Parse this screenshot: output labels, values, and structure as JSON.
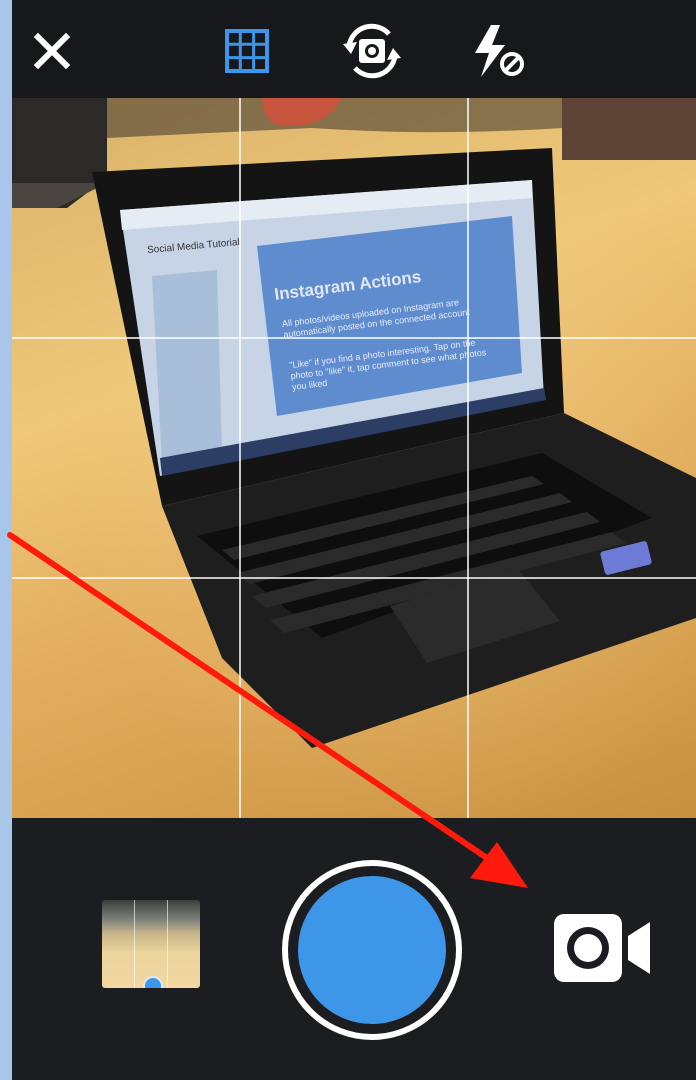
{
  "colors": {
    "accent": "#3d96e8",
    "arrow": "#ff1a0d",
    "bar_background": "#1b1d21"
  },
  "top_bar": {
    "close_icon": "close-icon",
    "grid_icon": "grid-icon",
    "flip_camera_icon": "flip-camera-icon",
    "flash_icon": "flash-off-icon"
  },
  "viewfinder": {
    "grid_visible": true,
    "grid_divisions": 3,
    "scene_text": {
      "slide_title": "Instagram Actions",
      "doc_tab": "Social Media Tutorial",
      "bullet_1": "All photos/videos uploaded on Instagram are automatically posted on the connected account",
      "bullet_2": "\"Like\" if you find a photo interesting. Tap on the photo to \"like\" it, tap comment to see what photos you liked"
    }
  },
  "bottom_bar": {
    "gallery_icon": "gallery-thumbnail",
    "shutter_icon": "shutter-button",
    "video_icon": "video-camera-icon"
  }
}
